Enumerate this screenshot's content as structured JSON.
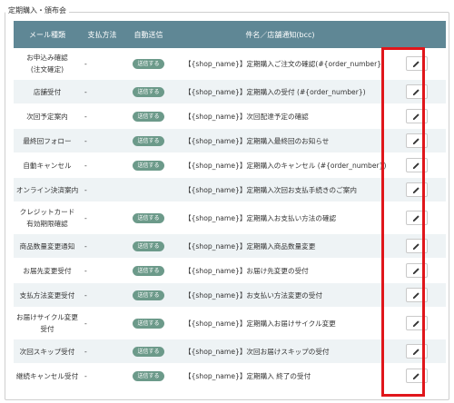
{
  "section_title": "定期購入・頒布会",
  "columns": {
    "mail_type": "メール種類",
    "payment": "支払方法",
    "auto_send": "自動送信",
    "subject": "件名／店舗通知(bcc)"
  },
  "badge_label": "送信する",
  "edit_icon": "pencil-icon",
  "highlight_color": "#e0161b",
  "header_color": "#5f8795",
  "rows": [
    {
      "name": "お申込み確認\n(注文確定)",
      "payment": "-",
      "auto": true,
      "subject": "【{shop_name}】定期購入ご注文の確認(#{order_number})"
    },
    {
      "name": "店舗受付",
      "payment": "-",
      "auto": true,
      "subject": "【{shop_name}】定期購入の受付 (#{order_number})"
    },
    {
      "name": "次回予定案内",
      "payment": "-",
      "auto": true,
      "subject": "【{shop_name}】次回配達予定の確認"
    },
    {
      "name": "最終回フォロー",
      "payment": "-",
      "auto": true,
      "subject": "【{shop_name}】定期購入最終回のお知らせ"
    },
    {
      "name": "自動キャンセル",
      "payment": "-",
      "auto": true,
      "subject": "【{shop_name}】定期購入のキャンセル (#{order_number})"
    },
    {
      "name": "オンライン決済案内",
      "payment": "-",
      "auto": false,
      "subject": "【{shop_name}】定期購入次回お支払手続きのご案内"
    },
    {
      "name": "クレジットカード\n有効期限確認",
      "payment": "-",
      "auto": true,
      "subject": "【{shop_name}】定期購入お支払い方法の確認"
    },
    {
      "name": "商品数量変更通知",
      "payment": "-",
      "auto": true,
      "subject": "【{shop_name}】定期購入商品数量変更"
    },
    {
      "name": "お届先変更受付",
      "payment": "-",
      "auto": true,
      "subject": "【{shop_name}】お届け先変更の受付"
    },
    {
      "name": "支払方法変更受付",
      "payment": "-",
      "auto": true,
      "subject": "【{shop_name}】お支払い方法変更の受付"
    },
    {
      "name": "お届けサイクル変更\n受付",
      "payment": "-",
      "auto": true,
      "subject": "【{shop_name}】定期購入お届けサイクル変更"
    },
    {
      "name": "次回スキップ受付",
      "payment": "-",
      "auto": true,
      "subject": "【{shop_name}】次回お届けスキップの受付"
    },
    {
      "name": "継続キャンセル受付",
      "payment": "-",
      "auto": true,
      "subject": "【{shop_name}】定期購入 終了の受付"
    }
  ]
}
